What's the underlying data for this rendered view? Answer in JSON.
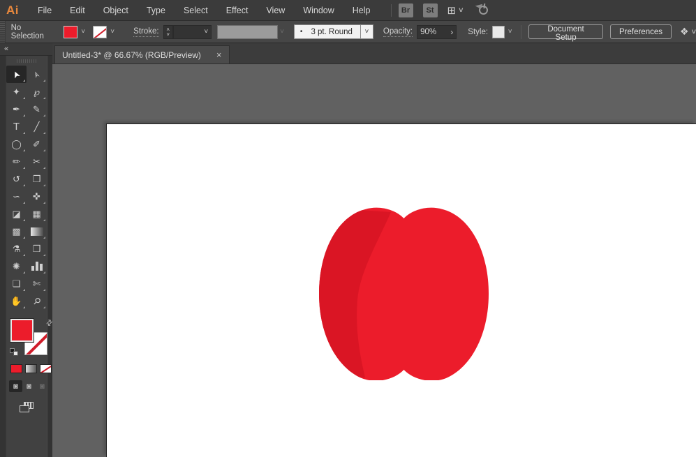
{
  "menubar": {
    "logo": "Ai",
    "items": [
      "File",
      "Edit",
      "Object",
      "Type",
      "Select",
      "Effect",
      "View",
      "Window",
      "Help"
    ],
    "bridge_label": "Br",
    "stock_label": "St",
    "workspace_icon": "⊞"
  },
  "controlbar": {
    "selection_status": "No Selection",
    "stroke_label": "Stroke:",
    "brush_bullet": "•",
    "brush_value": "3 pt. Round",
    "opacity_label": "Opacity:",
    "opacity_value": "90%",
    "style_label": "Style:",
    "document_setup_label": "Document Setup",
    "preferences_label": "Preferences",
    "select_similar_icon": "❖"
  },
  "tabbar": {
    "tab_title": "Untitled-3* @ 66.67% (RGB/Preview)",
    "close": "×"
  },
  "tooldock": {
    "collapse": "«",
    "tool_icons": {
      "selection": "➤",
      "direct-selection": "➣",
      "magic-wand": "✦",
      "lasso": "℘",
      "pen": "✒",
      "curvature": "✎",
      "type": "T",
      "line-segment": "╱",
      "ellipse": "◯",
      "paintbrush": "✐",
      "pencil": "✏",
      "scissors": "✂",
      "rotate": "↺",
      "scale": "❐",
      "width": "∽",
      "free-transform": "✜",
      "shape-builder": "◪",
      "perspective-grid": "▦",
      "mesh": "▩",
      "eyedropper": "⚗",
      "blend": "❒",
      "symbol-sprayer": "✺",
      "artboard": "❏",
      "slice": "✄",
      "hand": "✋",
      "zoom": "⚲",
      "draw-mode": "◙"
    }
  },
  "glyphs": {
    "chevron_down": "˅",
    "chevron_up": "˄",
    "arrow_right": "›",
    "swap": "⇄"
  },
  "colors": {
    "fill_red": "#ec1c2b",
    "apple_light_red": "#ec1c2b",
    "apple_dark_red": "#da1524",
    "pasteboard_gray": "#616161",
    "artboard_white": "#ffffff"
  }
}
